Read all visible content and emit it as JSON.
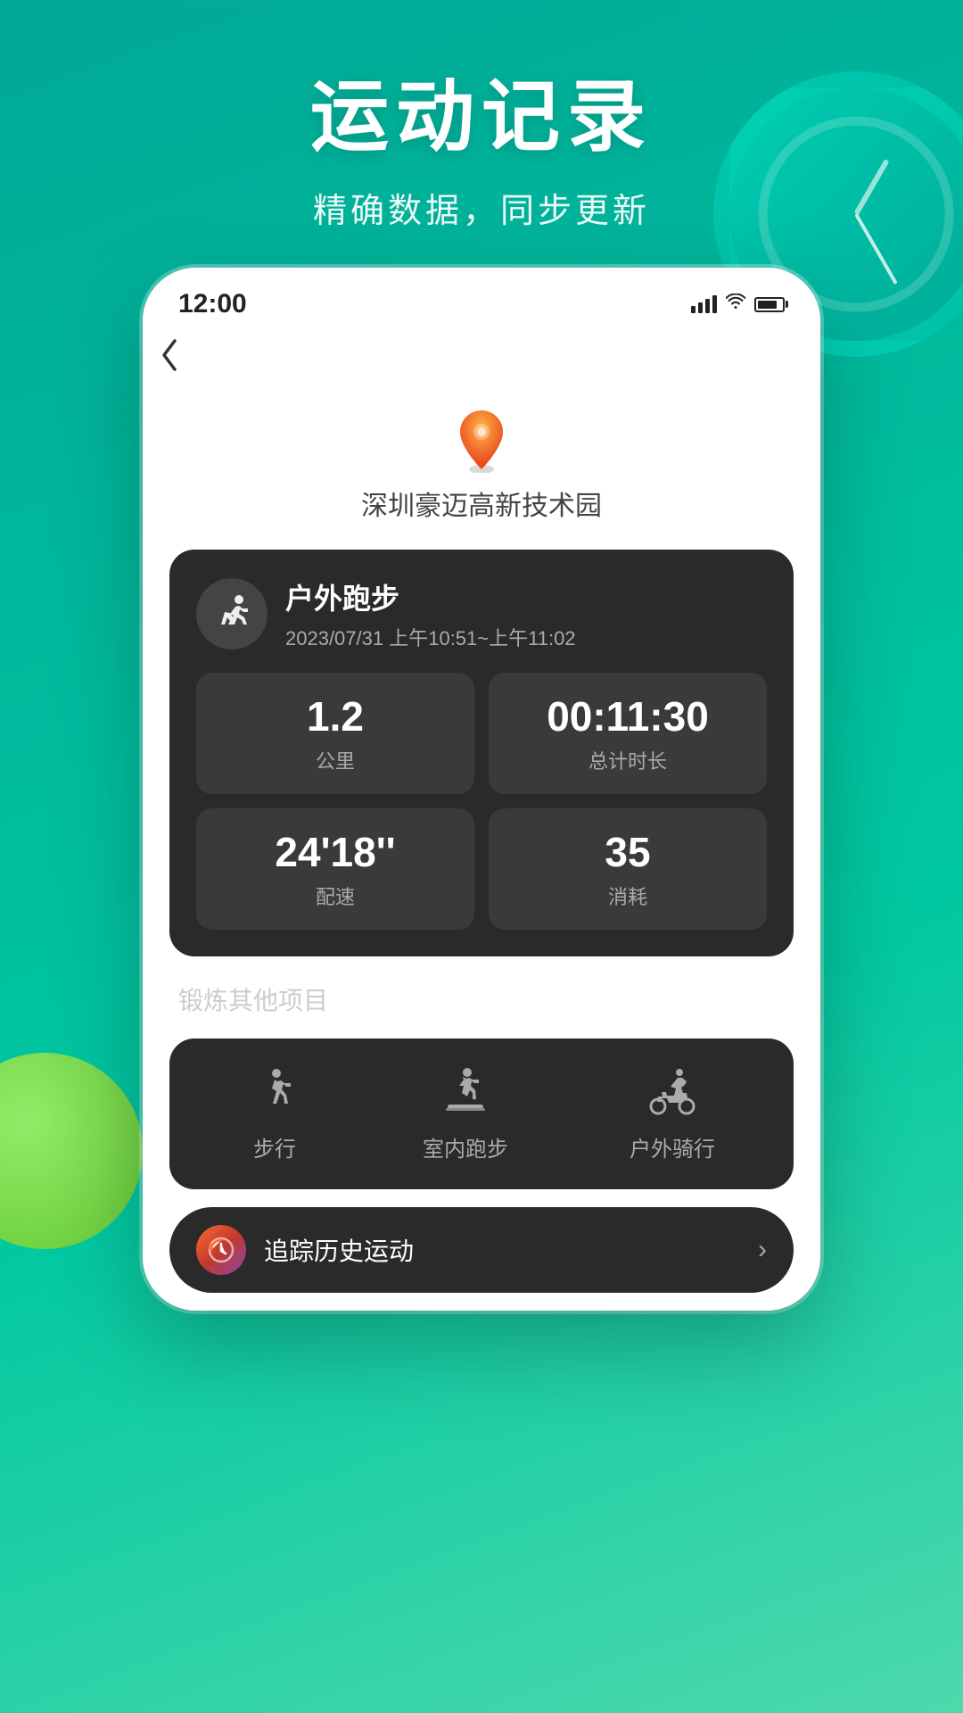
{
  "background": {
    "gradient_start": "#00a896",
    "gradient_end": "#4dd9ac"
  },
  "page_header": {
    "title": "运动记录",
    "subtitle": "精确数据，同步更新"
  },
  "status_bar": {
    "time": "12:00"
  },
  "back_button": "‹",
  "location": {
    "name": "深圳豪迈高新技术园"
  },
  "activity": {
    "type": "户外跑步",
    "time_range": "2023/07/31 上午10:51~上午11:02",
    "stats": [
      {
        "value": "1.2",
        "label": "公里"
      },
      {
        "value": "00:11:30",
        "label": "总计时长"
      },
      {
        "value": "24'18''",
        "label": "配速"
      },
      {
        "value": "35",
        "label": "消耗"
      }
    ]
  },
  "other_activities": {
    "section_title": "锻炼其他项目",
    "items": [
      {
        "label": "步行",
        "icon": "walking"
      },
      {
        "label": "室内跑步",
        "icon": "treadmill"
      },
      {
        "label": "户外骑行",
        "icon": "cycling"
      }
    ]
  },
  "history": {
    "label": "追踪历史运动"
  }
}
